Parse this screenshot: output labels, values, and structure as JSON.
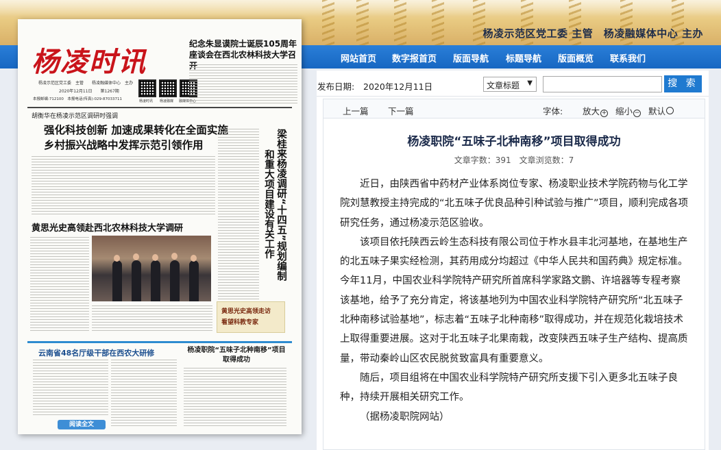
{
  "header": {
    "host": "杨凌示范区党工委 主管　杨凌融媒体中心 主办"
  },
  "nav": {
    "items": [
      "网站首页",
      "数字报首页",
      "版面导航",
      "标题导航",
      "版面概览",
      "联系我们"
    ]
  },
  "newspaper": {
    "masthead": "杨凌时讯",
    "sub": "杨凌示范区党工委　主管　　杨凌融媒体中心　主办",
    "date": "2020年12月11日　　第1267期",
    "number": "本报邮编:712100　本报电话(传真):029-87033711",
    "qr_labels": [
      "杨凌时讯",
      "杨凌融媒",
      "融媒体中心"
    ],
    "top_right_headline": "纪念朱显谟院士诞辰105周年座谈会在西北农林科技大学召开",
    "kicker1": "胡衡华在杨凌示范区调研时强调",
    "headline1": "强化科技创新 加速成果转化在全面实施乡村振兴战略中发挥示范引领作用",
    "vertical_headline_a": "梁桂来杨凌调研“十四五”规划编制",
    "vertical_headline_b": "和重大项目建设有关工作",
    "headline2": "黄思光史高领赴西北农林科技大学调研",
    "sidebox_line1": "黄思光史高领走访",
    "sidebox_line2": "看望科教专家",
    "bottom_headline1": "云南省48名厅级干部在西农大研修",
    "bottom_headline2": "杨凌职院“五味子北种南移”项目取得成功",
    "bottom_tag": "阅读全文"
  },
  "toolbar": {
    "date_label": "发布日期:",
    "date_value": "2020年12月11日",
    "select_value": "文章标题",
    "search_value": "",
    "search_button": "搜 索"
  },
  "article_nav": {
    "prev": "上一篇",
    "next": "下一篇",
    "font_label": "字体:",
    "font_larger": "放大",
    "font_smaller": "缩小",
    "font_default": "默认"
  },
  "article": {
    "title": "杨凌职院“五味子北种南移”项目取得成功",
    "stats": "文章字数：391　文章浏览数：7",
    "paragraphs": [
      "近日，由陕西省中药材产业体系岗位专家、杨凌职业技术学院药物与化工学院刘慧教授主持完成的“北五味子优良品种引种试验与推广”项目，顺利完成各项研究任务，通过杨凌示范区验收。",
      "该项目依托陕西云岭生态科技有限公司位于柞水县丰北河基地，在基地生产的北五味子果实经检测，其药用成分均超过《中华人民共和国药典》规定标准。今年11月，中国农业科学院特产研究所首席科学家路文鹏、许培器等专程考察该基地，给予了充分肯定，将该基地列为中国农业科学院特产研究所“北五味子北种南移试验基地”，标志着“五味子北种南移”取得成功，并在规范化栽培技术上取得重要进展。这对于北五味子北果南栽，改变陕西五味子生产结构、提高质量，带动秦岭山区农民脱贫致富具有重要意义。",
      "随后，项目组将在中国农业科学院特产研究所支援下引入更多北五味子良种，持续开展相关研究工作。",
      "（据杨凌职院网站）"
    ]
  },
  "colors": {
    "nav_blue": "#1f73cc",
    "masthead_red": "#c9141b",
    "button_blue": "#1f7ad0"
  }
}
